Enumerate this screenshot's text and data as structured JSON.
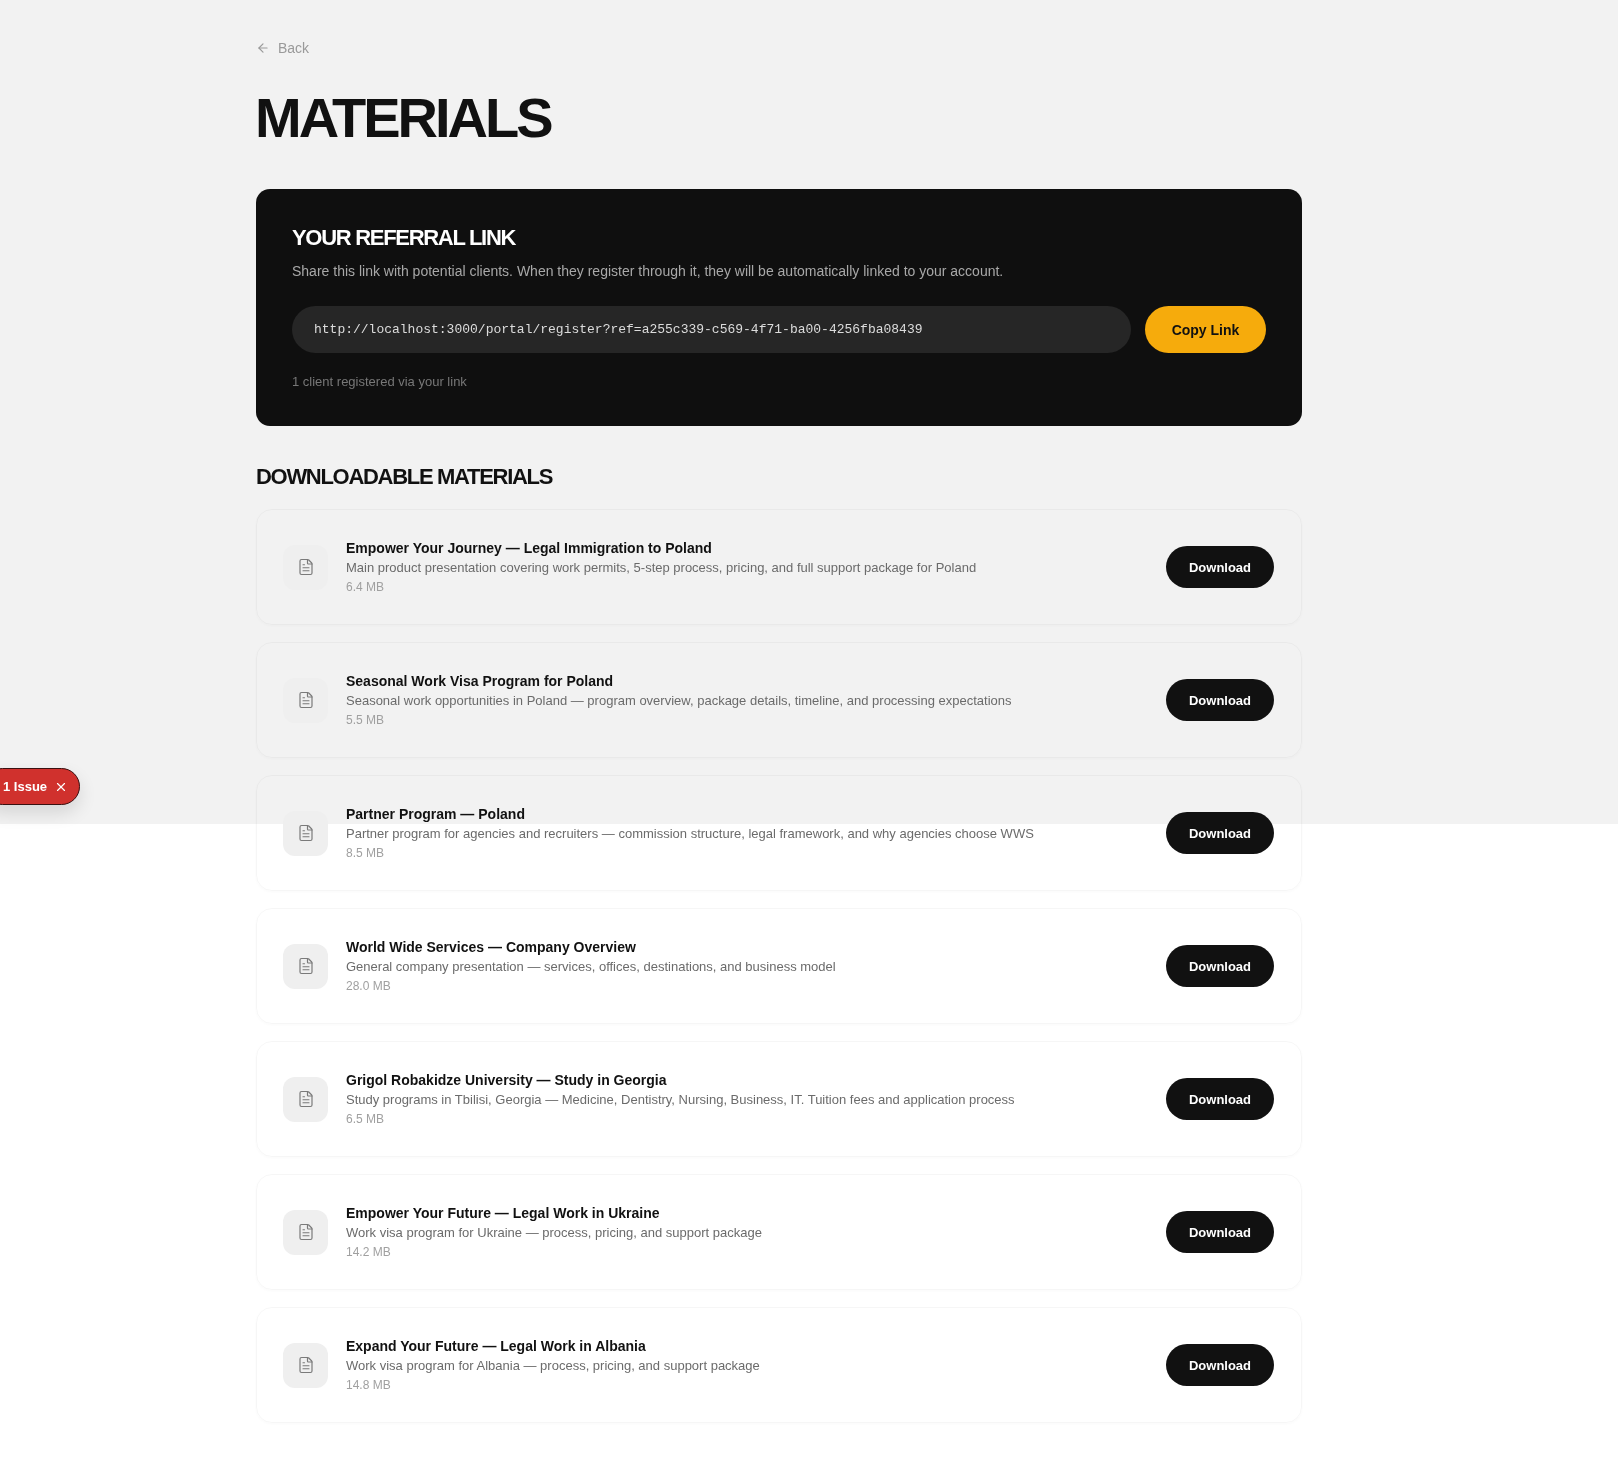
{
  "back_link": {
    "label": "Back"
  },
  "page_title": "MATERIALS",
  "referral": {
    "title": "YOUR REFERRAL LINK",
    "description": "Share this link with potential clients. When they register through it, they will be automatically linked to your account.",
    "link_field": {
      "value": "http://localhost:3000/portal/register?ref=a255c339-c569-4f71-ba00-4256fba08439"
    },
    "copy_button": "Copy Link",
    "footer": "1 client registered via your link"
  },
  "materials": {
    "title": "DOWNLOADABLE MATERIALS",
    "items": [
      {
        "title": "Empower Your Journey — Legal Immigration to Poland",
        "description": "Main product presentation covering work permits, 5-step process, pricing, and full support package for Poland",
        "size": "6.4 MB",
        "button": "Download"
      },
      {
        "title": "Seasonal Work Visa Program for Poland",
        "description": "Seasonal work opportunities in Poland — program overview, package details, timeline, and processing expectations",
        "size": "5.5 MB",
        "button": "Download"
      },
      {
        "title": "Partner Program — Poland",
        "description": "Partner program for agencies and recruiters — commission structure, legal framework, and why agencies choose WWS",
        "size": "8.5 MB",
        "button": "Download"
      },
      {
        "title": "World Wide Services — Company Overview",
        "description": "General company presentation — services, offices, destinations, and business model",
        "size": "28.0 MB",
        "button": "Download"
      },
      {
        "title": "Grigol Robakidze University — Study in Georgia",
        "description": "Study programs in Tbilisi, Georgia — Medicine, Dentistry, Nursing, Business, IT. Tuition fees and application process",
        "size": "6.5 MB",
        "button": "Download"
      },
      {
        "title": "Empower Your Future — Legal Work in Ukraine",
        "description": "Work visa program for Ukraine — process, pricing, and support package",
        "size": "14.2 MB",
        "button": "Download"
      },
      {
        "title": "Expand Your Future — Legal Work in Albania",
        "description": "Work visa program for Albania — process, pricing, and support package",
        "size": "14.8 MB",
        "button": "Download"
      }
    ]
  },
  "issue_badge": {
    "label": "1 Issue"
  }
}
